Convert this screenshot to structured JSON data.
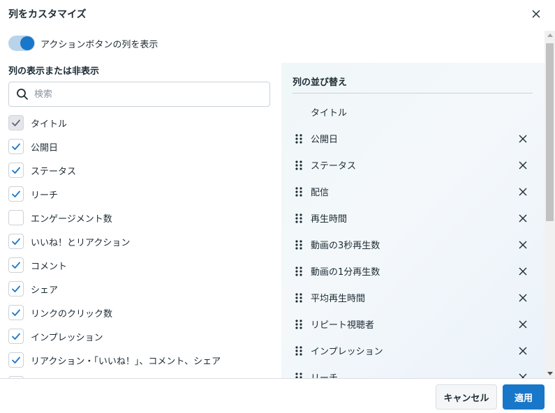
{
  "dialog": {
    "title": "列をカスタマイズ",
    "close_icon": "close-icon"
  },
  "toggle": {
    "label": "アクションボタンの列を表示",
    "on": true
  },
  "left": {
    "heading": "列の表示または非表示",
    "search": {
      "value": "",
      "placeholder": "検索"
    },
    "items": [
      {
        "label": "タイトル",
        "checked": true,
        "disabled": true
      },
      {
        "label": "公開日",
        "checked": true,
        "disabled": false
      },
      {
        "label": "ステータス",
        "checked": true,
        "disabled": false
      },
      {
        "label": "リーチ",
        "checked": true,
        "disabled": false
      },
      {
        "label": "エンゲージメント数",
        "checked": false,
        "disabled": false
      },
      {
        "label": "いいね！とリアクション",
        "checked": true,
        "disabled": false
      },
      {
        "label": "コメント",
        "checked": true,
        "disabled": false
      },
      {
        "label": "シェア",
        "checked": true,
        "disabled": false
      },
      {
        "label": "リンクのクリック数",
        "checked": true,
        "disabled": false
      },
      {
        "label": "インプレッション",
        "checked": true,
        "disabled": false
      },
      {
        "label": "リアクション・「いいね！」、コメント、シェア",
        "checked": true,
        "disabled": false
      },
      {
        "label": "",
        "checked": false,
        "disabled": false
      }
    ]
  },
  "right": {
    "heading": "列の並び替え",
    "items": [
      {
        "label": "タイトル",
        "fixed": true
      },
      {
        "label": "公開日",
        "fixed": false
      },
      {
        "label": "ステータス",
        "fixed": false
      },
      {
        "label": "配信",
        "fixed": false
      },
      {
        "label": "再生時間",
        "fixed": false
      },
      {
        "label": "動画の3秒再生数",
        "fixed": false
      },
      {
        "label": "動画の1分再生数",
        "fixed": false
      },
      {
        "label": "平均再生時間",
        "fixed": false
      },
      {
        "label": "リピート視聴者",
        "fixed": false
      },
      {
        "label": "インプレッション",
        "fixed": false
      },
      {
        "label": "リーチ",
        "fixed": false
      }
    ]
  },
  "footer": {
    "cancel_label": "キャンセル",
    "apply_label": "適用"
  },
  "colors": {
    "accent": "#1877c9",
    "check": "#1877c9",
    "disabled_check": "#606770"
  }
}
